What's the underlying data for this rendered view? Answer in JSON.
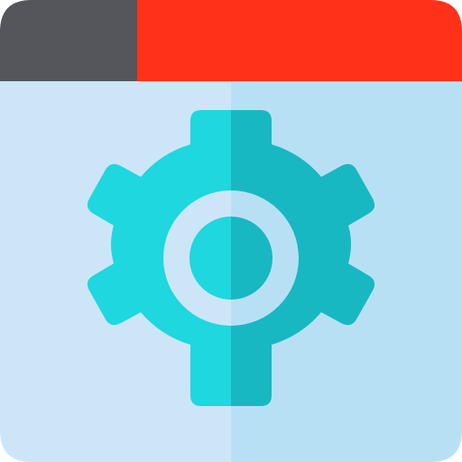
{
  "icon": {
    "name": "browser-settings-icon",
    "parts": [
      "window-titlebar",
      "window-body",
      "gear-icon"
    ]
  },
  "colors": {
    "titlebar_left": "#55555c",
    "titlebar_right": "#ff3119",
    "body_left": "#cce6f8",
    "body_right": "#b8e0f5",
    "gear_left": "#1ed7df",
    "gear_right": "#17b8c1"
  }
}
